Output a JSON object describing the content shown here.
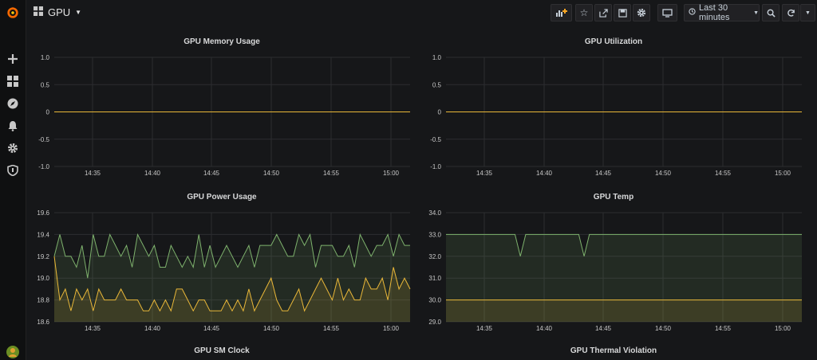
{
  "dashboard": {
    "title": "GPU",
    "time_range_label": "Last 30 minutes"
  },
  "sidebar": {
    "icons": [
      "grafana-logo-icon",
      "plus-icon",
      "dashboards-icon",
      "explore-compass-icon",
      "alert-bell-icon",
      "gear-icon",
      "shield-icon",
      "user-avatar-icon"
    ]
  },
  "colors": {
    "green": "#7eb26d",
    "yellow": "#eab839",
    "grid": "#2c2d30"
  },
  "panels": [
    {
      "title": "GPU Memory Usage",
      "chart_data": {
        "type": "line",
        "x_ticks": [
          "14:35",
          "14:40",
          "14:45",
          "14:50",
          "14:55",
          "15:00"
        ],
        "y_ticks": [
          "1.0",
          "0.5",
          "0",
          "-0.5",
          "-1.0"
        ],
        "ylim": [
          -1.0,
          1.0
        ],
        "series": [
          {
            "color": "#eab839",
            "fill": false,
            "values": [
              0,
              0
            ]
          }
        ]
      }
    },
    {
      "title": "GPU Utilization",
      "chart_data": {
        "type": "line",
        "x_ticks": [
          "14:35",
          "14:40",
          "14:45",
          "14:50",
          "14:55",
          "15:00"
        ],
        "y_ticks": [
          "1.0",
          "0.5",
          "0",
          "-0.5",
          "-1.0"
        ],
        "ylim": [
          -1.0,
          1.0
        ],
        "series": [
          {
            "color": "#eab839",
            "fill": false,
            "values": [
              0,
              0
            ]
          }
        ]
      }
    },
    {
      "title": "GPU Power Usage",
      "chart_data": {
        "type": "area",
        "x_ticks": [
          "14:35",
          "14:40",
          "14:45",
          "14:50",
          "14:55",
          "15:00"
        ],
        "y_ticks": [
          "19.6",
          "19.4",
          "19.2",
          "19.0",
          "18.8",
          "18.6"
        ],
        "ylim": [
          18.6,
          19.6
        ],
        "series": [
          {
            "color": "#7eb26d",
            "fill": true,
            "values": [
              19.2,
              19.4,
              19.2,
              19.2,
              19.1,
              19.3,
              19.0,
              19.4,
              19.2,
              19.2,
              19.4,
              19.3,
              19.2,
              19.3,
              19.1,
              19.4,
              19.3,
              19.2,
              19.3,
              19.1,
              19.1,
              19.3,
              19.2,
              19.1,
              19.2,
              19.1,
              19.4,
              19.1,
              19.3,
              19.1,
              19.2,
              19.3,
              19.2,
              19.1,
              19.2,
              19.3,
              19.1,
              19.3,
              19.3,
              19.3,
              19.4,
              19.3,
              19.2,
              19.2,
              19.4,
              19.3,
              19.4,
              19.1,
              19.3,
              19.3,
              19.3,
              19.2,
              19.2,
              19.3,
              19.1,
              19.4,
              19.3,
              19.2,
              19.3,
              19.3,
              19.4,
              19.2,
              19.4,
              19.3,
              19.3
            ]
          },
          {
            "color": "#eab839",
            "fill": true,
            "values": [
              19.2,
              18.8,
              18.9,
              18.7,
              18.9,
              18.8,
              18.9,
              18.7,
              18.9,
              18.8,
              18.8,
              18.8,
              18.9,
              18.8,
              18.8,
              18.8,
              18.7,
              18.7,
              18.8,
              18.7,
              18.8,
              18.7,
              18.9,
              18.9,
              18.8,
              18.7,
              18.8,
              18.8,
              18.7,
              18.7,
              18.7,
              18.8,
              18.7,
              18.8,
              18.7,
              18.9,
              18.7,
              18.8,
              18.9,
              19.0,
              18.8,
              18.7,
              18.7,
              18.8,
              18.9,
              18.7,
              18.8,
              18.9,
              19.0,
              18.9,
              18.8,
              19.0,
              18.8,
              18.9,
              18.8,
              18.8,
              19.0,
              18.9,
              18.9,
              19.0,
              18.8,
              19.1,
              18.9,
              19.0,
              18.9
            ]
          }
        ]
      }
    },
    {
      "title": "GPU Temp",
      "chart_data": {
        "type": "area",
        "x_ticks": [
          "14:35",
          "14:40",
          "14:45",
          "14:50",
          "14:55",
          "15:00"
        ],
        "y_ticks": [
          "34.0",
          "33.0",
          "32.0",
          "31.0",
          "30.0",
          "29.0"
        ],
        "ylim": [
          29.0,
          34.0
        ],
        "series": [
          {
            "color": "#7eb26d",
            "fill": true,
            "values": [
              33,
              33,
              33,
              33,
              33,
              33,
              33,
              33,
              33,
              33,
              33,
              33,
              33,
              33,
              32,
              33,
              33,
              33,
              33,
              33,
              33,
              33,
              33,
              33,
              33,
              33,
              32,
              33,
              33,
              33,
              33,
              33,
              33,
              33,
              33,
              33,
              33,
              33,
              33,
              33,
              33,
              33,
              33,
              33,
              33,
              33,
              33,
              33,
              33,
              33,
              33,
              33,
              33,
              33,
              33,
              33,
              33,
              33,
              33,
              33,
              33,
              33,
              33,
              33,
              33,
              33,
              33,
              33
            ]
          },
          {
            "color": "#eab839",
            "fill": true,
            "values": [
              30,
              30
            ]
          }
        ]
      }
    },
    {
      "title": "GPU SM Clock"
    },
    {
      "title": "GPU Thermal Violation"
    }
  ]
}
